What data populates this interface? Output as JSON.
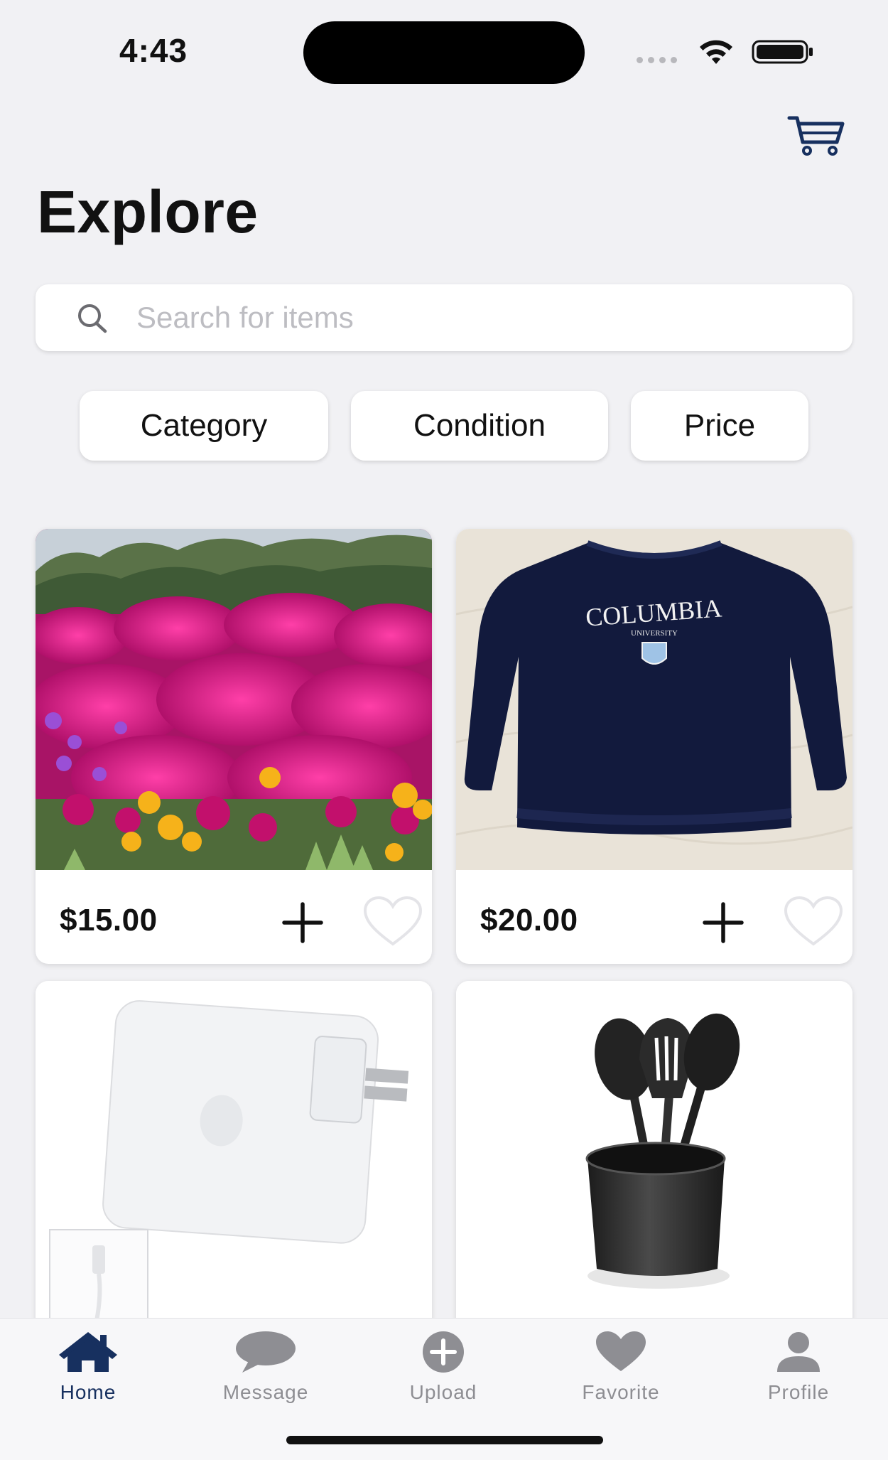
{
  "status_bar": {
    "time": "4:43",
    "icons": [
      "cellular-dots-icon",
      "wifi-icon",
      "battery-icon"
    ]
  },
  "header": {
    "title": "Explore",
    "cart_icon": "cart-icon"
  },
  "search": {
    "placeholder": "Search for items",
    "value": ""
  },
  "filters": [
    {
      "label": "Category"
    },
    {
      "label": "Condition"
    },
    {
      "label": "Price"
    }
  ],
  "products": [
    {
      "image": "magenta-flowers-photo",
      "price": "$15.00"
    },
    {
      "image": "columbia-university-sweatshirt-photo",
      "price": "$20.00"
    },
    {
      "image": "power-adapter-photo",
      "price": ""
    },
    {
      "image": "kitchen-utensils-photo",
      "price": ""
    }
  ],
  "tab_bar": {
    "items": [
      {
        "label": "Home",
        "icon": "home-icon",
        "active": true
      },
      {
        "label": "Message",
        "icon": "chat-bubble-icon",
        "active": false
      },
      {
        "label": "Upload",
        "icon": "plus-circle-icon",
        "active": false
      },
      {
        "label": "Favorite",
        "icon": "heart-icon",
        "active": false
      },
      {
        "label": "Profile",
        "icon": "person-icon",
        "active": false
      }
    ]
  },
  "colors": {
    "accent": "#17305f",
    "background": "#f1f1f4",
    "inactive_tab": "#8e8e93"
  }
}
